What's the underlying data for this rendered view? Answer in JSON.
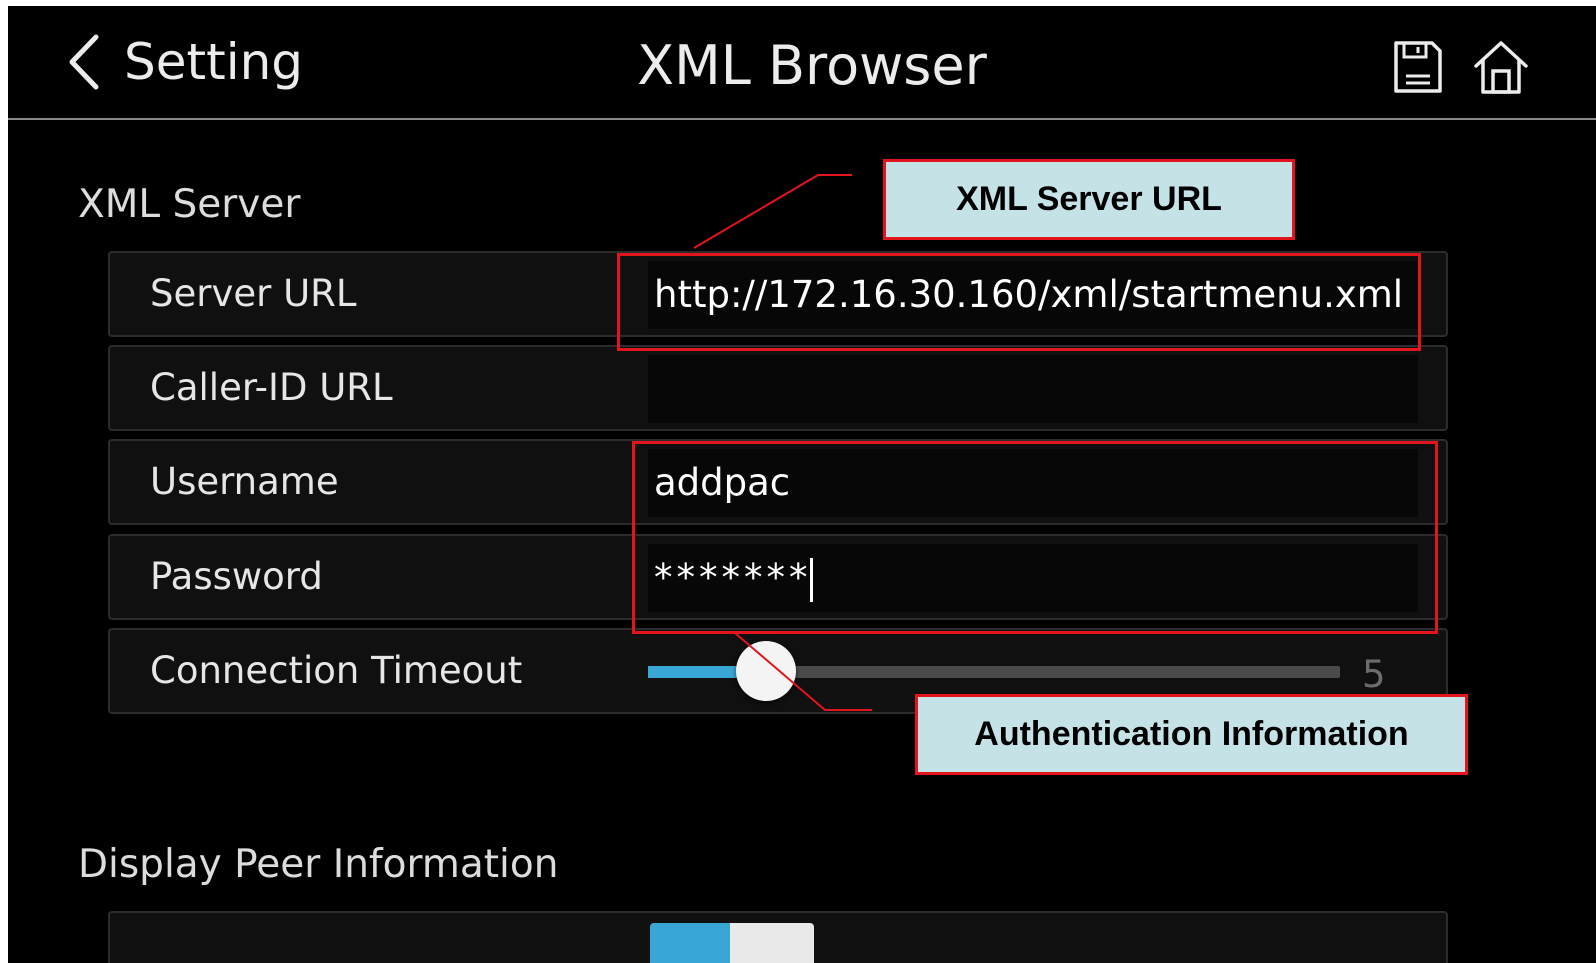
{
  "header": {
    "back_label": "Setting",
    "title": "XML Browser",
    "save_icon": "save-icon",
    "home_icon": "home-icon"
  },
  "sections": {
    "xml_server": "XML Server",
    "display_peer": "Display Peer Information"
  },
  "fields": {
    "server_url": {
      "label": "Server URL",
      "value": "http://172.16.30.160/xml/startmenu.xml"
    },
    "caller_id_url": {
      "label": "Caller-ID URL",
      "value": ""
    },
    "username": {
      "label": "Username",
      "value": "addpac"
    },
    "password": {
      "label": "Password",
      "value": "*******"
    },
    "connection_timeout": {
      "label": "Connection Timeout",
      "value": "5",
      "fraction": 0.17
    }
  },
  "toggle_row": {
    "state": "on"
  },
  "callouts": {
    "server_url": "XML Server URL",
    "auth": "Authentication Information"
  },
  "colors": {
    "accent": "#39a7d6",
    "highlight": "#e3151c",
    "callout_bg": "#c5e3e6"
  }
}
